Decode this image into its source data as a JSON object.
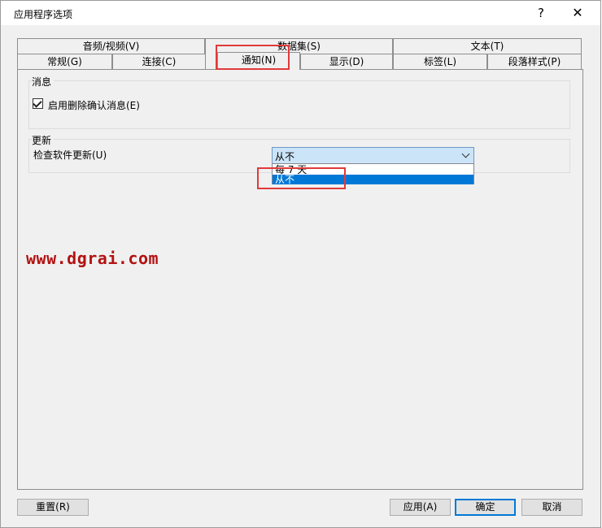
{
  "window": {
    "title": "应用程序选项",
    "help_label": "?",
    "close_label": "✕"
  },
  "tabs_back_row": [
    {
      "name": "tab-audio-video",
      "label": "音频/视频(V)"
    },
    {
      "name": "tab-dataset",
      "label": "数据集(S)"
    },
    {
      "name": "tab-text",
      "label": "文本(T)"
    }
  ],
  "tabs_front_row": [
    {
      "name": "tab-general",
      "label": "常规(G)"
    },
    {
      "name": "tab-connection",
      "label": "连接(C)"
    },
    {
      "name": "tab-notification",
      "label": "通知(N)",
      "active": true
    },
    {
      "name": "tab-display",
      "label": "显示(D)"
    },
    {
      "name": "tab-labels",
      "label": "标签(L)"
    },
    {
      "name": "tab-paragraph-style",
      "label": "段落样式(P)"
    }
  ],
  "messages_group": {
    "title": "消息",
    "delete_confirm_label": "启用删除确认消息(E)",
    "delete_confirm_checked": true
  },
  "update_group": {
    "title": "更新",
    "check_label": "检查软件更新(U)",
    "selected_value": "从不",
    "options": [
      "每 7 天",
      "从不"
    ],
    "highlighted_option": "从不"
  },
  "buttons": {
    "reset": "重置(R)",
    "apply": "应用(A)",
    "ok": "确定",
    "cancel": "取消"
  },
  "watermark": "www.dgrai.com",
  "colors": {
    "accent": "#0078d7",
    "highlight_box": "#e03a3a",
    "watermark": "#b31212"
  }
}
